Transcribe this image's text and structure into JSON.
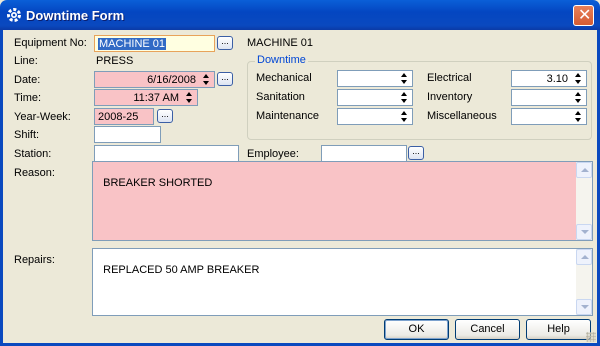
{
  "window": {
    "title": "Downtime Form",
    "close_symbol": "✕"
  },
  "labels": {
    "equipment_no": "Equipment No:",
    "line": "Line:",
    "date": "Date:",
    "time": "Time:",
    "year_week": "Year-Week:",
    "shift": "Shift:",
    "station": "Station:",
    "employee": "Employee:",
    "reason": "Reason:",
    "repairs": "Repairs:"
  },
  "fields": {
    "equipment_no": "MACHINE 01",
    "equipment_desc": "MACHINE 01",
    "line": "PRESS",
    "date": "6/16/2008",
    "time": "11:37 AM",
    "year_week": "2008-25",
    "shift": "",
    "station": "",
    "employee": "",
    "reason": "BREAKER SHORTED",
    "repairs": "REPLACED 50 AMP BREAKER"
  },
  "downtime": {
    "group_title": "Downtime",
    "mechanical_label": "Mechanical",
    "mechanical_value": "",
    "sanitation_label": "Sanitation",
    "sanitation_value": "",
    "maintenance_label": "Maintenance",
    "maintenance_value": "",
    "electrical_label": "Electrical",
    "electrical_value": "3.10",
    "inventory_label": "Inventory",
    "inventory_value": "",
    "miscellaneous_label": "Miscellaneous",
    "miscellaneous_value": ""
  },
  "buttons": {
    "lookup": "...",
    "ok": "OK",
    "cancel": "Cancel",
    "help": "Help"
  },
  "colors": {
    "required_field": "#f9c3c6",
    "title_bar": "#0a49bf",
    "group_title": "#0046d5"
  }
}
